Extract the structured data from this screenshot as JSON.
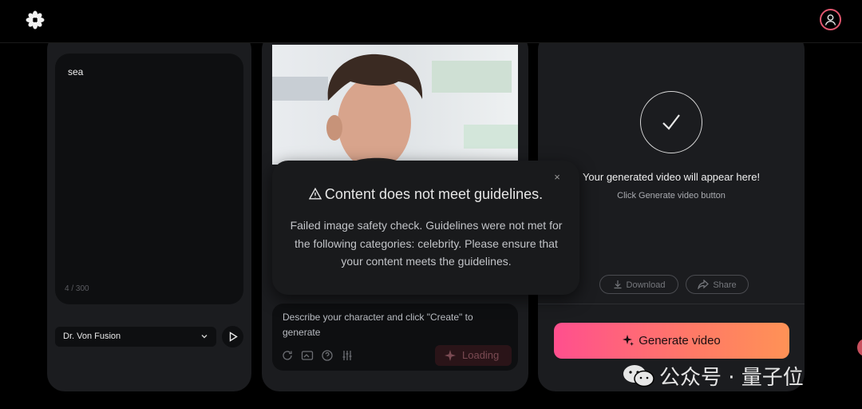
{
  "header": {
    "logo_icon": "flower-logo-icon",
    "profile_icon": "user-profile-icon"
  },
  "left_panel": {
    "prompt_text": "sea",
    "char_count": "4 / 300",
    "voice_select": "Dr. Von Fusion",
    "play_icon": "play-icon"
  },
  "middle_panel": {
    "description_placeholder": "Describe your character and click \"Create\" to generate",
    "tools": [
      "refresh-icon",
      "image-swap-icon",
      "help-icon",
      "sliders-icon"
    ],
    "loading_label": "Loading"
  },
  "modal": {
    "title": "Content does not meet guidelines.",
    "body": "Failed image safety check. Guidelines were not met for the following categories: celebrity. Please ensure that your content meets the guidelines.",
    "close": "×"
  },
  "right_panel": {
    "title": "Your generated video will appear here!",
    "subtitle": "Click Generate video button",
    "download_label": "Download",
    "share_label": "Share",
    "generate_label": "Generate video"
  },
  "watermark": "公众号 · 量子位",
  "colors": {
    "accent_start": "#ff4f8e",
    "accent_end": "#ff9256",
    "panel": "#1b1c1f"
  }
}
